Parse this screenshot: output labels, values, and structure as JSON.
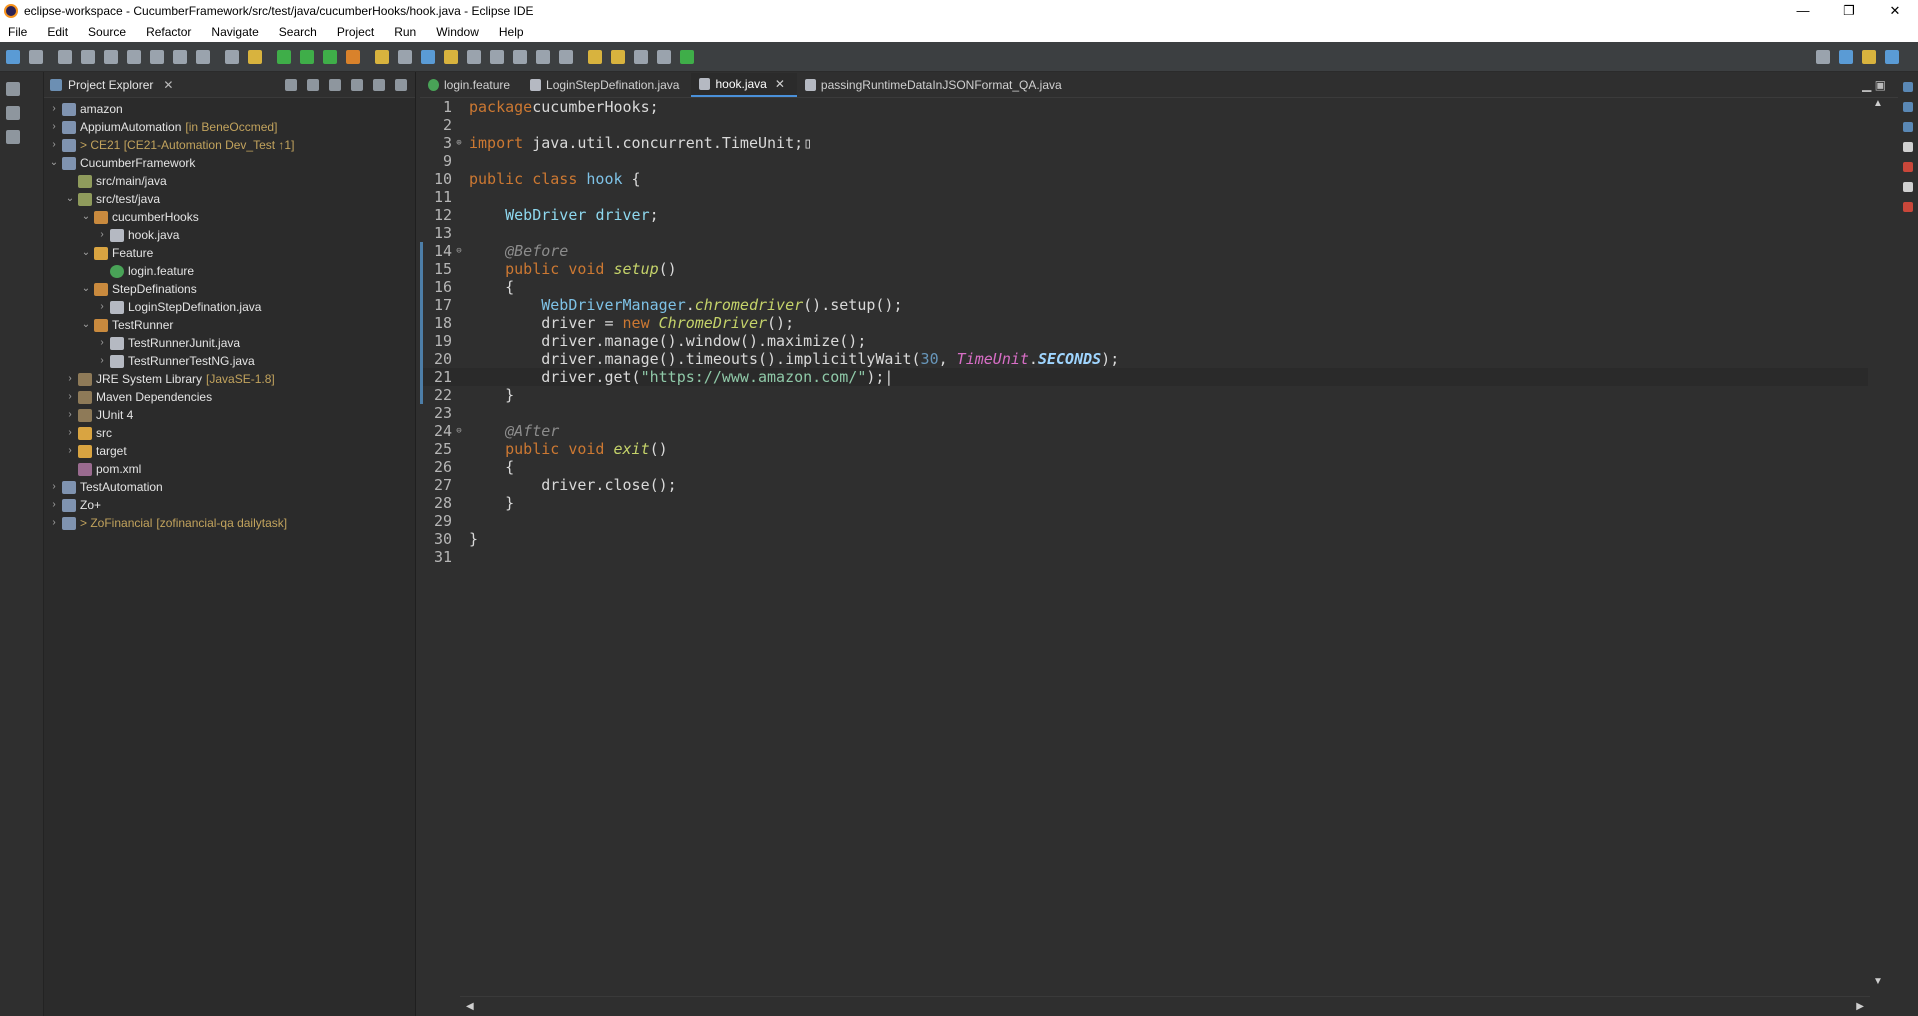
{
  "window": {
    "title": "eclipse-workspace - CucumberFramework/src/test/java/cucumberHooks/hook.java - Eclipse IDE",
    "minimize": "—",
    "restore": "❐",
    "close": "✕"
  },
  "menu": [
    "File",
    "Edit",
    "Source",
    "Refactor",
    "Navigate",
    "Search",
    "Project",
    "Run",
    "Window",
    "Help"
  ],
  "explorer": {
    "title": "Project Explorer",
    "close": "✕",
    "tree": [
      {
        "indent": 0,
        "arrow": "›",
        "icon": "project",
        "label": "amazon",
        "dec": ""
      },
      {
        "indent": 0,
        "arrow": "›",
        "icon": "project",
        "label": "AppiumAutomation",
        "dec": "[in BeneOccmed]"
      },
      {
        "indent": 0,
        "arrow": "›",
        "icon": "project",
        "label": "> CE21 [CE21-Automation Dev_Test ↑1]",
        "dec": "",
        "git": true
      },
      {
        "indent": 0,
        "arrow": "⌄",
        "icon": "project",
        "label": "CucumberFramework",
        "dec": ""
      },
      {
        "indent": 1,
        "arrow": "",
        "icon": "srcfolder",
        "label": "src/main/java",
        "dec": ""
      },
      {
        "indent": 1,
        "arrow": "⌄",
        "icon": "srcfolder",
        "label": "src/test/java",
        "dec": ""
      },
      {
        "indent": 2,
        "arrow": "⌄",
        "icon": "package",
        "label": "cucumberHooks",
        "dec": ""
      },
      {
        "indent": 3,
        "arrow": "›",
        "icon": "file",
        "label": "hook.java",
        "dec": ""
      },
      {
        "indent": 2,
        "arrow": "⌄",
        "icon": "folder",
        "label": "Feature",
        "dec": ""
      },
      {
        "indent": 3,
        "arrow": "",
        "icon": "feature",
        "label": "login.feature",
        "dec": ""
      },
      {
        "indent": 2,
        "arrow": "⌄",
        "icon": "package",
        "label": "StepDefinations",
        "dec": ""
      },
      {
        "indent": 3,
        "arrow": "›",
        "icon": "file",
        "label": "LoginStepDefination.java",
        "dec": ""
      },
      {
        "indent": 2,
        "arrow": "⌄",
        "icon": "package",
        "label": "TestRunner",
        "dec": ""
      },
      {
        "indent": 3,
        "arrow": "›",
        "icon": "file",
        "label": "TestRunnerJunit.java",
        "dec": ""
      },
      {
        "indent": 3,
        "arrow": "›",
        "icon": "file",
        "label": "TestRunnerTestNG.java",
        "dec": ""
      },
      {
        "indent": 1,
        "arrow": "›",
        "icon": "lib",
        "label": "JRE System Library",
        "dec": "[JavaSE-1.8]"
      },
      {
        "indent": 1,
        "arrow": "›",
        "icon": "lib",
        "label": "Maven Dependencies",
        "dec": ""
      },
      {
        "indent": 1,
        "arrow": "›",
        "icon": "lib",
        "label": "JUnit 4",
        "dec": ""
      },
      {
        "indent": 1,
        "arrow": "›",
        "icon": "folder",
        "label": "src",
        "dec": ""
      },
      {
        "indent": 1,
        "arrow": "›",
        "icon": "folder",
        "label": "target",
        "dec": ""
      },
      {
        "indent": 1,
        "arrow": "",
        "icon": "pom",
        "label": "pom.xml",
        "dec": ""
      },
      {
        "indent": 0,
        "arrow": "›",
        "icon": "project",
        "label": "TestAutomation",
        "dec": ""
      },
      {
        "indent": 0,
        "arrow": "›",
        "icon": "project",
        "label": "Zo+",
        "dec": ""
      },
      {
        "indent": 0,
        "arrow": "›",
        "icon": "project",
        "label": "> ZoFinancial",
        "dec": "[zofinancial-qa dailytask]",
        "git": true
      }
    ]
  },
  "tabs": [
    {
      "label": "login.feature",
      "icon": "feature",
      "active": false
    },
    {
      "label": "LoginStepDefination.java",
      "icon": "file",
      "active": false
    },
    {
      "label": "hook.java",
      "icon": "file",
      "active": true
    },
    {
      "label": "passingRuntimeDataInJSONFormat_QA.java",
      "icon": "file",
      "active": false
    }
  ],
  "tab_close": "✕",
  "code": [
    {
      "n": "1",
      "fold": "",
      "parts": [
        [
          "kw",
          "package"
        ],
        [
          "",
          "cucumberHooks;"
        ]
      ]
    },
    {
      "n": "2",
      "fold": "",
      "parts": []
    },
    {
      "n": "3",
      "fold": "⊕",
      "parts": [
        [
          "kw",
          "import"
        ],
        [
          "",
          " java.util.concurrent.TimeUnit;"
        ],
        [
          "",
          "▯"
        ]
      ]
    },
    {
      "n": "9",
      "fold": "",
      "parts": []
    },
    {
      "n": "10",
      "fold": "",
      "parts": [
        [
          "kw",
          "public class"
        ],
        [
          "",
          " "
        ],
        [
          "hook",
          "hook"
        ],
        [
          "",
          " {"
        ]
      ]
    },
    {
      "n": "11",
      "fold": "",
      "parts": []
    },
    {
      "n": "12",
      "fold": "",
      "parts": [
        [
          "",
          "    "
        ],
        [
          "ty",
          "WebDriver"
        ],
        [
          "",
          " "
        ],
        [
          "ty",
          "driver"
        ],
        [
          "",
          ";"
        ]
      ]
    },
    {
      "n": "13",
      "fold": "",
      "parts": []
    },
    {
      "n": "14",
      "fold": "⊖",
      "parts": [
        [
          "",
          "    "
        ],
        [
          "ann",
          "@Before"
        ]
      ]
    },
    {
      "n": "15",
      "fold": "",
      "parts": [
        [
          "",
          "    "
        ],
        [
          "kw",
          "public void"
        ],
        [
          "",
          " "
        ],
        [
          "meth",
          "setup"
        ],
        [
          "",
          "()"
        ]
      ]
    },
    {
      "n": "16",
      "fold": "",
      "parts": [
        [
          "",
          "    {"
        ]
      ]
    },
    {
      "n": "17",
      "fold": "",
      "parts": [
        [
          "",
          "        "
        ],
        [
          "cls",
          "WebDriverManager"
        ],
        [
          "",
          "."
        ],
        [
          "meth",
          "chromedriver"
        ],
        [
          "",
          "().setup();"
        ]
      ]
    },
    {
      "n": "18",
      "fold": "",
      "parts": [
        [
          "",
          "        driver = "
        ],
        [
          "kw",
          "new"
        ],
        [
          "",
          " "
        ],
        [
          "meth",
          "ChromeDriver"
        ],
        [
          "",
          "();"
        ]
      ]
    },
    {
      "n": "19",
      "fold": "",
      "parts": [
        [
          "",
          "        driver.manage().window().maximize();"
        ]
      ]
    },
    {
      "n": "20",
      "fold": "",
      "parts": [
        [
          "",
          "        driver.manage().timeouts().implicitlyWait("
        ],
        [
          "num",
          "30"
        ],
        [
          "",
          ", "
        ],
        [
          "typ2",
          "TimeUnit"
        ],
        [
          "",
          "."
        ],
        [
          "stat",
          "SECONDS"
        ],
        [
          "",
          ");"
        ]
      ]
    },
    {
      "n": "21",
      "fold": "",
      "cur": true,
      "parts": [
        [
          "",
          "        driver.get("
        ],
        [
          "str",
          "\"https://www.amazon.com/\""
        ],
        [
          "",
          ");|"
        ]
      ]
    },
    {
      "n": "22",
      "fold": "",
      "parts": [
        [
          "",
          "    }"
        ]
      ]
    },
    {
      "n": "23",
      "fold": "",
      "parts": []
    },
    {
      "n": "24",
      "fold": "⊖",
      "parts": [
        [
          "",
          "    "
        ],
        [
          "ann",
          "@After"
        ]
      ]
    },
    {
      "n": "25",
      "fold": "",
      "parts": [
        [
          "",
          "    "
        ],
        [
          "kw",
          "public void"
        ],
        [
          "",
          " "
        ],
        [
          "meth",
          "exit"
        ],
        [
          "",
          "()"
        ]
      ]
    },
    {
      "n": "26",
      "fold": "",
      "parts": [
        [
          "",
          "    {"
        ]
      ]
    },
    {
      "n": "27",
      "fold": "",
      "parts": [
        [
          "",
          "        driver.close();"
        ]
      ]
    },
    {
      "n": "28",
      "fold": "",
      "parts": [
        [
          "",
          "    }"
        ]
      ]
    },
    {
      "n": "29",
      "fold": "",
      "parts": []
    },
    {
      "n": "30",
      "fold": "",
      "parts": [
        [
          "",
          "}"
        ]
      ]
    },
    {
      "n": "31",
      "fold": "",
      "parts": []
    }
  ],
  "scroll": {
    "up": "▲",
    "down": "▼",
    "left": "◀",
    "right": "▶"
  }
}
